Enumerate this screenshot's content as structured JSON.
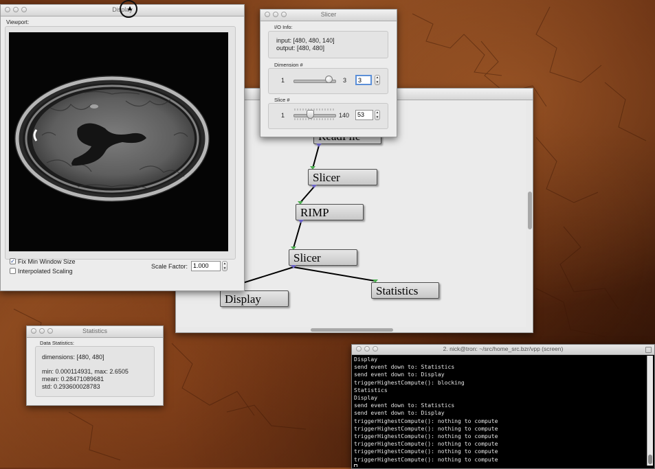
{
  "display_window": {
    "title": "Display",
    "viewport_label": "Viewport:",
    "fix_min_label": "Fix Min Window Size",
    "fix_min_checked": true,
    "interp_label": "Interpolated Scaling",
    "interp_checked": false,
    "scale_label": "Scale Factor:",
    "scale_value": "1.000"
  },
  "slicer_window": {
    "title": "Slicer",
    "io_label": "I/O Info:",
    "input_text": "input: [480, 480, 140]",
    "output_text": "output: [480, 480]",
    "dimension_label": "Dimension #",
    "dim_min": "1",
    "dim_max": "3",
    "dim_value": "3",
    "slice_label": "Slice #",
    "slice_min": "1",
    "slice_max": "140",
    "slice_value": "53"
  },
  "pipeline": {
    "nodes": {
      "readfile": "ReadFile",
      "slicer1": "Slicer",
      "rimp": "RIMP",
      "slicer2": "Slicer",
      "display": "Display",
      "statistics": "Statistics"
    }
  },
  "statistics_window": {
    "title": "Statistics",
    "group_label": "Data Statistics:",
    "dimensions": "dimensions: [480, 480]",
    "minmax": "min: 0.000114931, max: 2.6505",
    "mean": "mean: 0.28471089681",
    "std": "std: 0.293600028783"
  },
  "terminal": {
    "title": "2. nick@tron: ~/src/home_src.bzr/vpp (screen)",
    "lines": [
      "Display",
      "send event down to: Statistics",
      "send event down to: Display",
      "triggerHighestCompute(): blocking",
      "Statistics",
      "Display",
      "send event down to: Statistics",
      "send event down to: Display",
      "triggerHighestCompute(): nothing to compute",
      "triggerHighestCompute(): nothing to compute",
      "triggerHighestCompute(): nothing to compute",
      "triggerHighestCompute(): nothing to compute",
      "triggerHighestCompute(): nothing to compute",
      "triggerHighestCompute(): nothing to compute"
    ]
  },
  "colors": {
    "input_port": "#4caf50",
    "output_port": "#6b63c8"
  }
}
